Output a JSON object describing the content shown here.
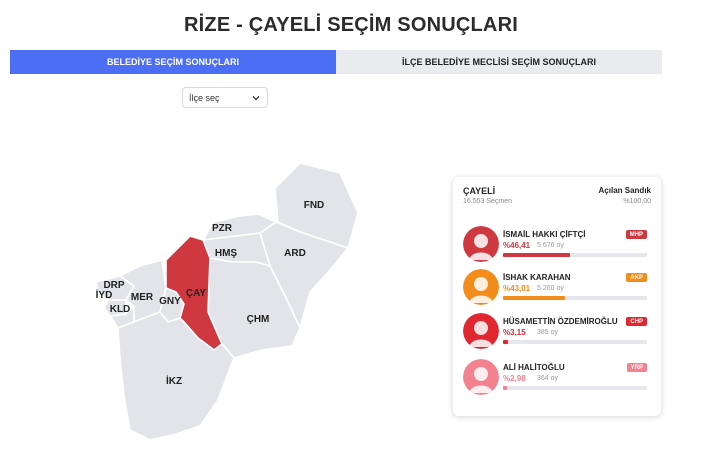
{
  "page": {
    "title": "RİZE - ÇAYELİ SEÇİM SONUÇLARI"
  },
  "tabs": [
    {
      "label": "BELEDİYE SEÇİM SONUÇLARI",
      "active": true
    },
    {
      "label": "İLÇE BELEDİYE MECLİSİ SEÇİM SONUÇLARI",
      "active": false
    }
  ],
  "district_select": {
    "value": "İlçe seç"
  },
  "map": {
    "regions": [
      {
        "code": "FND",
        "selected": false
      },
      {
        "code": "PZR",
        "selected": false
      },
      {
        "code": "ARD",
        "selected": false
      },
      {
        "code": "HMŞ",
        "selected": false
      },
      {
        "code": "DRP",
        "selected": false
      },
      {
        "code": "İYD",
        "selected": false
      },
      {
        "code": "MER",
        "selected": false
      },
      {
        "code": "KLD",
        "selected": false
      },
      {
        "code": "GNY",
        "selected": false
      },
      {
        "code": "ÇAY",
        "selected": true
      },
      {
        "code": "ÇHM",
        "selected": false
      },
      {
        "code": "İKZ",
        "selected": false
      }
    ],
    "colors": {
      "region": "#e3e4ea",
      "selected": "#d0383f"
    }
  },
  "results": {
    "district": "ÇAYELİ",
    "voters": "16.553 Seçmen",
    "opened_label": "Açılan Sandık",
    "opened_value": "%100,00",
    "candidates": [
      {
        "name": "İSMAİL HAKKI ÇİFTÇİ",
        "percent": "%46,41",
        "votes": "5.676 oy",
        "party": "MHP",
        "color": "#d0383f",
        "share": 46.41
      },
      {
        "name": "İSHAK KARAHAN",
        "percent": "%43,01",
        "votes": "5.260 oy",
        "party": "AKP",
        "color": "#f28c1b",
        "share": 43.01
      },
      {
        "name": "HÜSAMETTİN ÖZDEMİROĞLU",
        "percent": "%3,15",
        "votes": "385 oy",
        "party": "CHP",
        "color": "#e0262f",
        "share": 3.15
      },
      {
        "name": "ALİ HALİTOĞLU",
        "percent": "%2,98",
        "votes": "364 oy",
        "party": "YRP",
        "color": "#f3818e",
        "share": 2.98
      }
    ]
  }
}
